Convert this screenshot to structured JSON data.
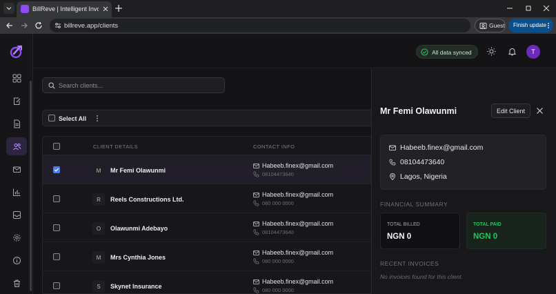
{
  "browser": {
    "tab_title": "BillReve | Intelligent Invoicing &",
    "url": "billreve.app/clients",
    "guest_label": "Guest",
    "update_label": "Finish update"
  },
  "header": {
    "sync_status": "All data synced",
    "avatar_initial": "T"
  },
  "search": {
    "placeholder": "Search clients..."
  },
  "toolbar": {
    "select_all_label": "Select All"
  },
  "table": {
    "columns": {
      "details": "CLIENT DETAILS",
      "contact": "CONTACT INFO"
    },
    "rows": [
      {
        "initial": "M",
        "name": "Mr Femi Olawunmi",
        "email": "Habeeb.finex@gmail.com",
        "phone": "08104473640",
        "checked": true
      },
      {
        "initial": "R",
        "name": "Reels Constructions Ltd.",
        "email": "Habeeb.finex@gmail.com",
        "phone": "080 000 0000",
        "checked": false
      },
      {
        "initial": "O",
        "name": "Olawunmi Adebayo",
        "email": "Habeeb.finex@gmail.com",
        "phone": "08104473640",
        "checked": false
      },
      {
        "initial": "M",
        "name": "Mrs Cynthia Jones",
        "email": "Habeeb.finex@gmail.com",
        "phone": "080 000 0000",
        "checked": false
      },
      {
        "initial": "S",
        "name": "Skynet Insurance",
        "email": "Habeeb.finex@gmail.com",
        "phone": "080 000 0000",
        "checked": false
      }
    ]
  },
  "drawer": {
    "title": "Mr Femi Olawunmi",
    "edit_label": "Edit Client",
    "email": "Habeeb.finex@gmail.com",
    "phone": "08104473640",
    "location": "Lagos, Nigeria",
    "financial_title": "FINANCIAL SUMMARY",
    "total_billed_label": "TOTAL BILLED",
    "total_billed_value": "NGN 0",
    "total_paid_label": "TOTAL PAID",
    "total_paid_value": "NGN 0",
    "recent_title": "RECENT INVOICES",
    "recent_empty": "No invoices found for this client."
  },
  "colors": {
    "accent": "#8d4bf6",
    "success": "#22c55e",
    "checkbox": "#4a7de8"
  }
}
